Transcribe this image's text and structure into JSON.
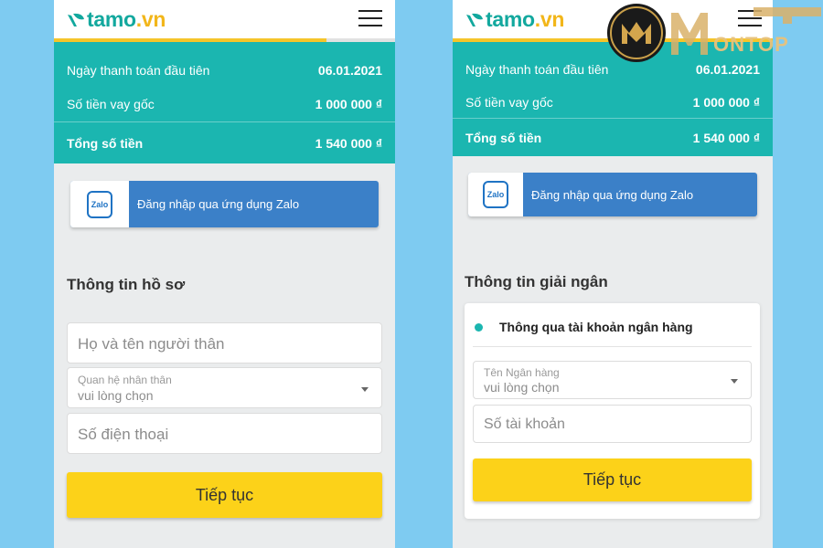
{
  "left": {
    "brand": {
      "name": "tamo",
      "domain": ".vn"
    },
    "summary": {
      "rows": [
        {
          "label": "Ngày thanh toán đầu tiên",
          "value": "06.01.2021"
        },
        {
          "label": "Số tiền vay gốc",
          "value": "1 000 000 ₫"
        }
      ],
      "total": {
        "label": "Tổng số tiền",
        "value": "1 540 000 ₫"
      }
    },
    "zalo": {
      "logo_text": "Zalo",
      "label": "Đăng nhập qua ứng dụng Zalo"
    },
    "section_title": "Thông tin hồ sơ",
    "fields": {
      "name_placeholder": "Họ và tên người thân",
      "relation_label": "Quan hệ nhân thân",
      "relation_value": "vui lòng chọn",
      "phone_placeholder": "Số điện thoại"
    },
    "button": "Tiếp tục"
  },
  "right": {
    "brand": {
      "name": "tamo",
      "domain": ".vn"
    },
    "summary": {
      "rows": [
        {
          "label": "Ngày thanh toán đầu tiên",
          "value": "06.01.2021"
        },
        {
          "label": "Số tiền vay gốc",
          "value": "1 000 000 ₫"
        }
      ],
      "total": {
        "label": "Tổng số tiền",
        "value": "1 540 000 ₫"
      }
    },
    "zalo": {
      "logo_text": "Zalo",
      "label": "Đăng nhập qua ứng dụng Zalo"
    },
    "section_title": "Thông tin giải ngân",
    "option": "Thông qua tài khoản ngân hàng",
    "fields": {
      "bank_label": "Tên Ngân hàng",
      "bank_value": "vui lòng chọn",
      "account_placeholder": "Số tài khoản"
    },
    "button": "Tiếp tục"
  },
  "watermark": {
    "text": "ONTOP"
  },
  "colors": {
    "teal": "#1bb6b0",
    "yellow": "#fcd219",
    "zalo_blue": "#3b80c8",
    "background": "#7ecbf1"
  },
  "progress": {
    "left_fraction": 0.8,
    "right_fraction": 1.0
  }
}
